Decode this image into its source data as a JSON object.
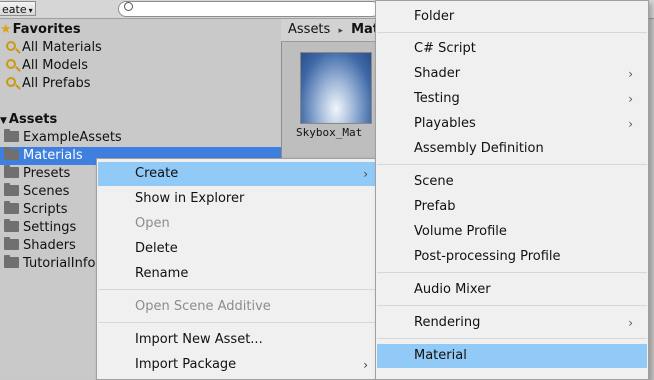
{
  "toolbar": {
    "create_label": "eate",
    "create_caret": "▾",
    "search_placeholder": ""
  },
  "tree": {
    "favorites_label": "Favorites",
    "favorites": [
      "All Materials",
      "All Models",
      "All Prefabs"
    ],
    "assets_label": "Assets",
    "folders": [
      "ExampleAssets",
      "Materials",
      "Presets",
      "Scenes",
      "Scripts",
      "Settings",
      "Shaders",
      "TutorialInfo"
    ],
    "selected_folder": "Materials"
  },
  "assets_panel": {
    "breadcrumb": [
      "Assets",
      "Mat"
    ],
    "breadcrumb_sep": "▸",
    "item_label": "Skybox_Mat"
  },
  "context_menu": {
    "items": [
      {
        "label": "Create",
        "submenu": true,
        "active": true
      },
      {
        "label": "Show in Explorer"
      },
      {
        "label": "Open",
        "disabled": true
      },
      {
        "label": "Delete"
      },
      {
        "label": "Rename"
      },
      {
        "label": "Open Scene Additive",
        "disabled": true
      },
      {
        "label": "Import New Asset..."
      },
      {
        "label": "Import Package",
        "submenu": true
      }
    ]
  },
  "create_submenu": {
    "items": [
      {
        "label": "Folder"
      },
      {
        "label": "C# Script"
      },
      {
        "label": "Shader",
        "submenu": true
      },
      {
        "label": "Testing",
        "submenu": true
      },
      {
        "label": "Playables",
        "submenu": true
      },
      {
        "label": "Assembly Definition"
      },
      {
        "label": "Scene"
      },
      {
        "label": "Prefab"
      },
      {
        "label": "Volume Profile"
      },
      {
        "label": "Post-processing Profile"
      },
      {
        "label": "Audio Mixer"
      },
      {
        "label": "Rendering",
        "submenu": true
      },
      {
        "label": "Material",
        "active": true
      }
    ]
  },
  "glyphs": {
    "chevron": "›",
    "star": "★",
    "arrow_down": "▼"
  },
  "colors": {
    "selection": "#3e7fe0",
    "menu_hover": "#91c9f7"
  }
}
